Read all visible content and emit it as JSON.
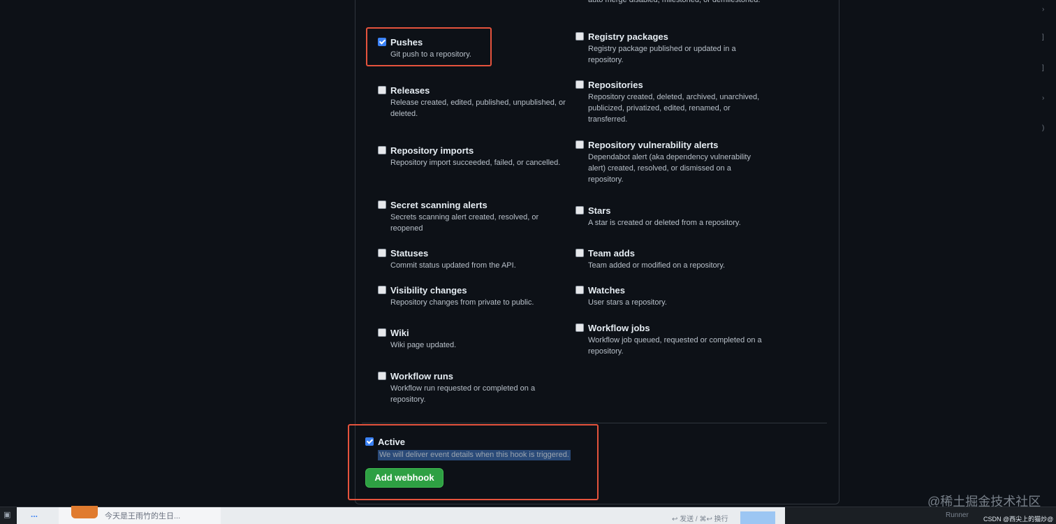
{
  "top_tail": "auto merge disabled, milestoned, or demilestoned.",
  "events_left": [
    {
      "title": "Pushes",
      "desc": "Git push to a repository.",
      "checked": true
    },
    {
      "title": "Releases",
      "desc": "Release created, edited, published, unpublished, or deleted.",
      "checked": false
    },
    {
      "title": "Repository imports",
      "desc": "Repository import succeeded, failed, or cancelled.",
      "checked": false
    },
    {
      "title": "Secret scanning alerts",
      "desc": "Secrets scanning alert created, resolved, or reopened",
      "checked": false
    },
    {
      "title": "Statuses",
      "desc": "Commit status updated from the API.",
      "checked": false
    },
    {
      "title": "Visibility changes",
      "desc": "Repository changes from private to public.",
      "checked": false
    },
    {
      "title": "Wiki",
      "desc": "Wiki page updated.",
      "checked": false
    },
    {
      "title": "Workflow runs",
      "desc": "Workflow run requested or completed on a repository.",
      "checked": false
    }
  ],
  "events_right": [
    {
      "title": "Registry packages",
      "desc": "Registry package published or updated in a repository.",
      "checked": false
    },
    {
      "title": "Repositories",
      "desc": "Repository created, deleted, archived, unarchived, publicized, privatized, edited, renamed, or transferred.",
      "checked": false
    },
    {
      "title": "Repository vulnerability alerts",
      "desc": "Dependabot alert (aka dependency vulnerability alert) created, resolved, or dismissed on a repository.",
      "checked": false
    },
    {
      "title": "Stars",
      "desc": "A star is created or deleted from a repository.",
      "checked": false
    },
    {
      "title": "Team adds",
      "desc": "Team added or modified on a repository.",
      "checked": false
    },
    {
      "title": "Watches",
      "desc": "User stars a repository.",
      "checked": false
    },
    {
      "title": "Workflow jobs",
      "desc": "Workflow job queued, requested or completed on a repository.",
      "checked": false
    }
  ],
  "active": {
    "title": "Active",
    "desc": "We will deliver event details when this hook is triggered.",
    "checked": true
  },
  "submit_label": "Add webhook",
  "highlight_color": "#e5533d",
  "chat": {
    "dots": "...",
    "preview": "今天是王雨竹的生日...",
    "hint": "↩ 发送 / ⌘↩ 换行"
  },
  "footer": {
    "runner": "Runner",
    "csdn": "CSDN @西尖上的猫炒@"
  },
  "watermark": "@稀土掘金技术社区"
}
